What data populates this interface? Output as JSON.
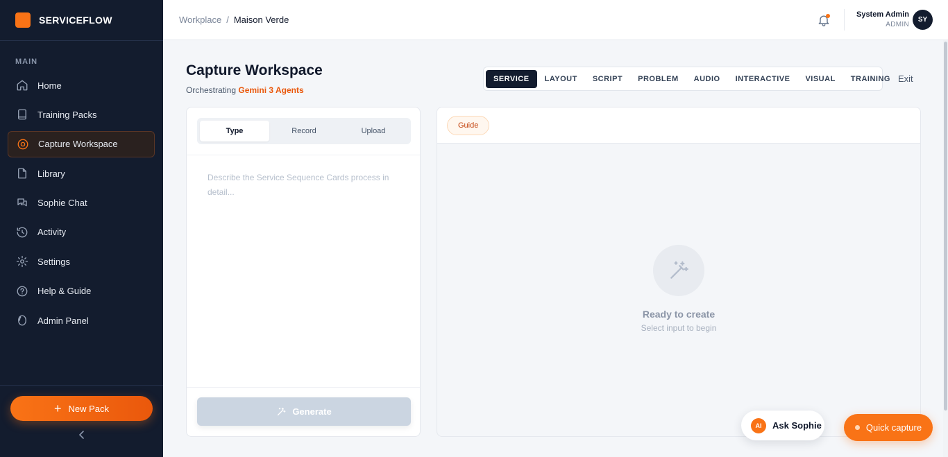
{
  "brand": {
    "name": "SERVICEFLOW",
    "color": "#f97316"
  },
  "sidebar": {
    "section_label": "MAIN",
    "items": [
      {
        "label": "Home",
        "icon": "home-icon"
      },
      {
        "label": "Training Packs",
        "icon": "book-icon"
      },
      {
        "label": "Capture Workspace",
        "icon": "target-icon",
        "active": true
      },
      {
        "label": "Library",
        "icon": "file-icon"
      },
      {
        "label": "Sophie Chat",
        "icon": "chat-icon"
      },
      {
        "label": "Activity",
        "icon": "history-icon"
      },
      {
        "label": "Settings",
        "icon": "gear-icon"
      },
      {
        "label": "Help & Guide",
        "icon": "help-icon"
      },
      {
        "label": "Admin Panel",
        "icon": "shield-icon"
      }
    ],
    "new_pack_label": "New Pack",
    "collapse_icon": "chevron-left-icon"
  },
  "header": {
    "breadcrumb": [
      "Workplace",
      "Maison Verde"
    ],
    "breadcrumb_separator": "/",
    "notification_icon": "bell-icon",
    "user": {
      "name": "System Admin",
      "role": "ADMIN",
      "initials": "SY"
    }
  },
  "page": {
    "title": "Capture Workspace",
    "subtitle_prefix": "Orchestrating",
    "subtitle_accent": "Gemini 3 Agents",
    "mode_tabs": [
      "SERVICE",
      "LAYOUT",
      "SCRIPT",
      "PROBLEM",
      "AUDIO",
      "INTERACTIVE",
      "VISUAL",
      "TRAINING"
    ],
    "active_mode": "SERVICE",
    "exit_label": "Exit"
  },
  "input_panel": {
    "tabs": [
      "Type",
      "Record",
      "Upload"
    ],
    "active_tab": "Type",
    "placeholder": "Describe the Service Sequence Cards process in detail...",
    "generate_label": "Generate"
  },
  "output_panel": {
    "guide_label": "Guide",
    "empty_title": "Ready to create",
    "empty_subtitle": "Select input to begin"
  },
  "floating": {
    "ask_badge": "AI",
    "ask_label": "Ask Sophie",
    "quick_capture_label": "Quick capture"
  }
}
